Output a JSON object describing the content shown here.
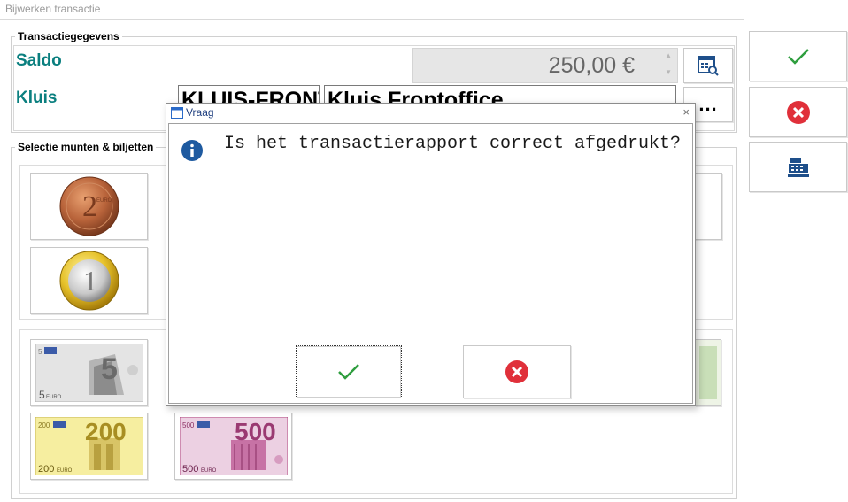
{
  "window": {
    "title": "Bijwerken transactie"
  },
  "transaction": {
    "group_label": "Transactiegegevens",
    "saldo_label": "Saldo",
    "saldo_value": "250,00 €",
    "kluis_label": "Kluis",
    "kluis_code": "KLUIS-FRONT",
    "kluis_name": "Kluis Frontoffice",
    "browse_label": "..."
  },
  "selection": {
    "group_label": "Selectie munten & biljetten",
    "coins": [
      {
        "label": "2",
        "icon": "two-euro-coin-icon"
      },
      {
        "label": "1",
        "icon": "one-euro-coin-icon"
      }
    ],
    "notes": [
      {
        "label": "5",
        "prefix": "5",
        "icon": "five-euro-note-icon",
        "color": "#9a9a9a"
      },
      {
        "label": "200",
        "prefix": "200",
        "icon": "two-hundred-euro-note-icon",
        "color": "#e0c44a"
      },
      {
        "label": "500",
        "prefix": "500",
        "icon": "five-hundred-euro-note-icon",
        "color": "#b0467e"
      }
    ]
  },
  "side_actions": {
    "confirm_icon": "checkmark-icon",
    "cancel_icon": "cancel-icon",
    "register_icon": "cash-register-icon"
  },
  "dialog": {
    "title": "Vraag",
    "close": "×",
    "message": "Is het transactierapport correct afgedrukt?",
    "ok_icon": "checkmark-icon",
    "cancel_icon": "cancel-icon"
  },
  "colors": {
    "accent_teal": "#0a7f7f",
    "confirm_green": "#2e9e3e",
    "cancel_red": "#e0303a",
    "info_blue": "#1e5aa0"
  }
}
